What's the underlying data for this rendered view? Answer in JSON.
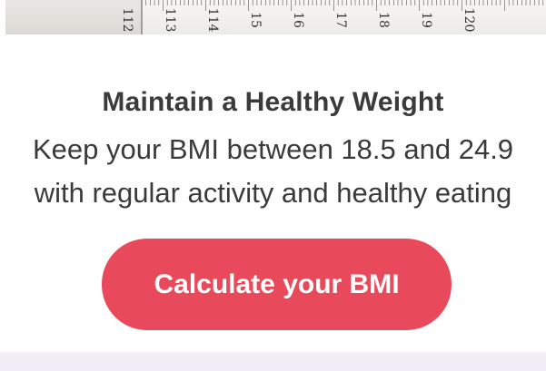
{
  "tape": {
    "numbers": [
      "112",
      "113",
      "114",
      "15",
      "16",
      "17",
      "18",
      "19",
      "120"
    ]
  },
  "content": {
    "headline": "Maintain a Healthy Weight",
    "line1": "Keep your BMI between 18.5 and 24.9",
    "line2": "with regular activity and healthy eating"
  },
  "cta": {
    "label": "Calculate your BMI"
  },
  "colors": {
    "accent": "#e84a5b",
    "text": "#3a3a3a",
    "bottom_bar": "#f1eef8"
  }
}
